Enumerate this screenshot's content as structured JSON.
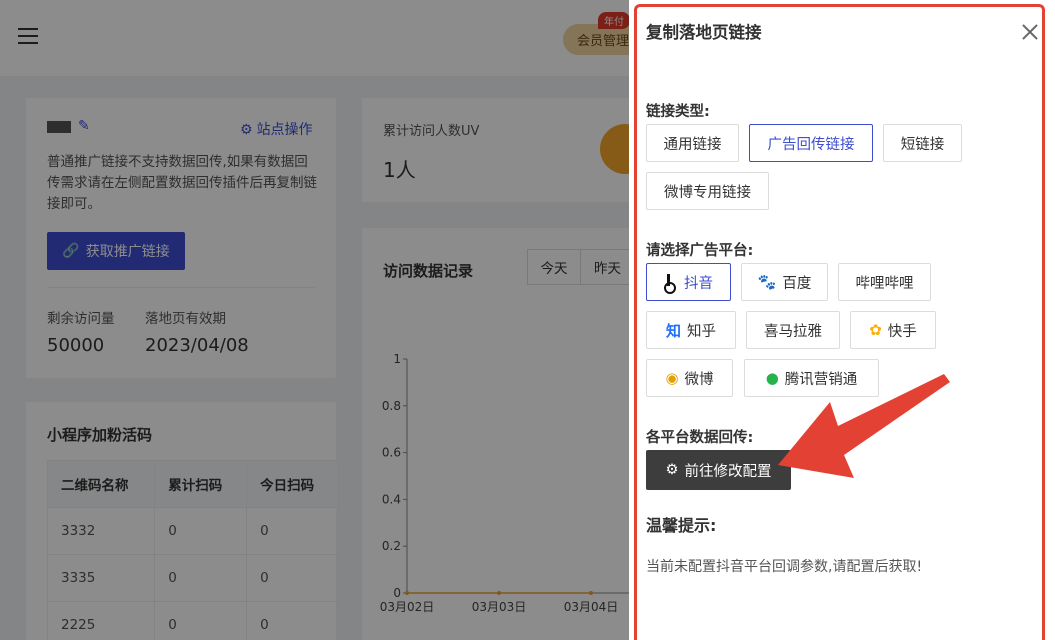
{
  "header": {
    "member_label": "会员管理",
    "member_tag": "年付"
  },
  "site_card": {
    "site_ops": "站点操作",
    "note": "普通推广链接不支持数据回传,如果有数据回传需求请在左侧配置数据回传插件后再复制链接即可。",
    "promo_button": "获取推广链接",
    "remaining_label": "剩余访问量",
    "remaining_value": "50000",
    "expiry_label": "落地页有效期",
    "expiry_value": "2023/04/08"
  },
  "qr_card": {
    "title": "小程序加粉活码",
    "columns": [
      "二维码名称",
      "累计扫码",
      "今日扫码"
    ],
    "rows": [
      [
        "3332",
        "0",
        "0"
      ],
      [
        "3335",
        "0",
        "0"
      ],
      [
        "2225",
        "0",
        "0"
      ]
    ]
  },
  "uv_card": {
    "label": "累计访问人数UV",
    "value": "1人"
  },
  "visit_card": {
    "title": "访问数据记录",
    "tabs": [
      "今天",
      "昨天"
    ]
  },
  "chart_data": {
    "type": "line",
    "x": [
      "03月02日",
      "03月03日",
      "03月04日"
    ],
    "series": [
      {
        "values": [
          0,
          0,
          0
        ]
      }
    ],
    "ylim": [
      0,
      1
    ],
    "yticks": [
      "0",
      "0.2",
      "0.4",
      "0.6",
      "0.8",
      "1"
    ]
  },
  "dialog": {
    "title": "复制落地页链接",
    "link_type_label": "链接类型:",
    "link_types": [
      "通用链接",
      "广告回传链接",
      "短链接",
      "微博专用链接"
    ],
    "active_link_type": "广告回传链接",
    "platform_label": "请选择广告平台:",
    "platforms": [
      {
        "label": "抖音",
        "icon": "tiktok-icon"
      },
      {
        "label": "百度",
        "icon": "baidu-icon"
      },
      {
        "label": "哔哩哔哩",
        "icon": ""
      },
      {
        "label": "知乎",
        "icon": "zhihu-icon"
      },
      {
        "label": "喜马拉雅",
        "icon": ""
      },
      {
        "label": "快手",
        "icon": "kuaishou-icon"
      },
      {
        "label": "微博",
        "icon": "weibo-icon"
      },
      {
        "label": "腾讯营销通",
        "icon": "wechat-icon"
      }
    ],
    "active_platform": "抖音",
    "callback_label": "各平台数据回传:",
    "config_button": "前往修改配置",
    "tip_title": "温馨提示:",
    "tip_text": "当前未配置抖音平台回调参数,请配置后获取!"
  },
  "colors": {
    "accent": "#3d4ed1",
    "annotation": "#e34133"
  }
}
